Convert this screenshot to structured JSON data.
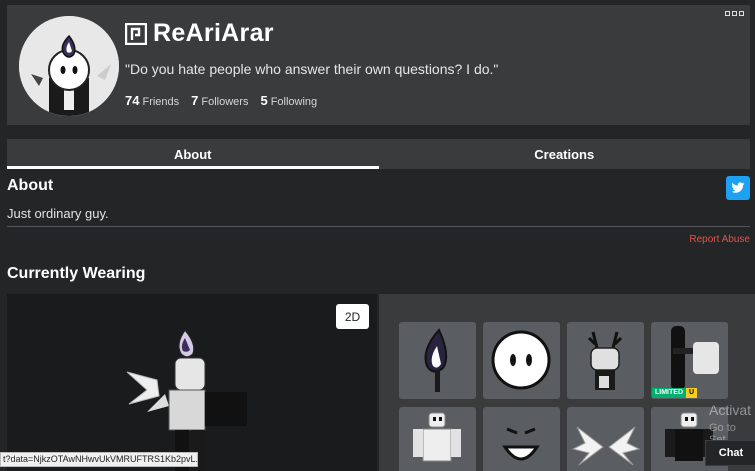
{
  "profile": {
    "username": "ReAriArar",
    "status": "\"Do you hate people who answer their own questions? I do.\"",
    "friends_count": "74",
    "friends_label": "Friends",
    "followers_count": "7",
    "followers_label": "Followers",
    "following_count": "5",
    "following_label": "Following"
  },
  "tabs": [
    {
      "label": "About",
      "active": true
    },
    {
      "label": "Creations",
      "active": false
    }
  ],
  "about": {
    "title": "About",
    "text": "Just ordinary guy.",
    "report_label": "Report Abuse"
  },
  "wearing": {
    "title": "Currently Wearing",
    "view_toggle_label": "2D",
    "limited_label": "LIMITED",
    "unique_label": "U"
  },
  "browser": {
    "status_url": "t?data=NjkzOTAwNHwvUkVMRUFTRS1Kb2pvL...",
    "activate_text": "Activat",
    "activate_sub": "Go to Set"
  },
  "chat": {
    "label": "Chat"
  },
  "colors": {
    "background": "#232527",
    "panel": "#393b3d",
    "twitter": "#1da1f2",
    "report": "#e0544b"
  }
}
